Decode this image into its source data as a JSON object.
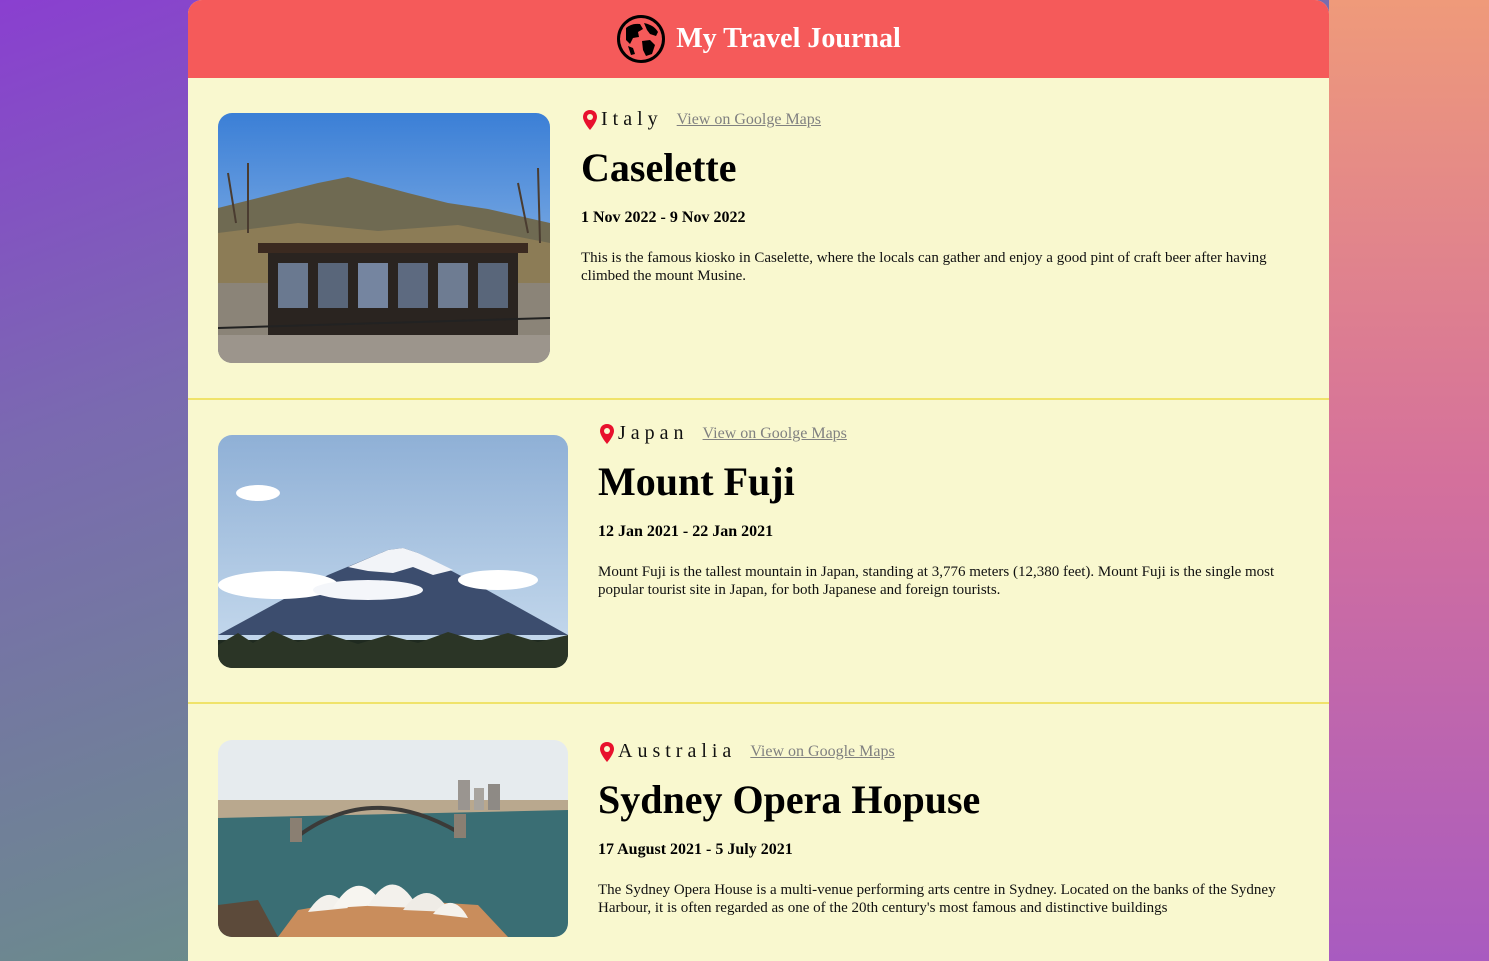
{
  "header": {
    "title": "My Travel Journal",
    "icon": "globe-icon"
  },
  "entries": [
    {
      "country": "Italy",
      "maps_label": "View on Goolge Maps",
      "title": "Caselette",
      "dates": "1 Nov 2022 - 9 Nov 2022",
      "description": "This is the famous kiosko in Caselette, where the locals can gather and enjoy a good pint of craft beer after having climbed the mount Musine."
    },
    {
      "country": "Japan",
      "maps_label": "View on Goolge Maps",
      "title": "Mount Fuji",
      "dates": "12 Jan 2021 - 22 Jan 2021",
      "description": "Mount Fuji is the tallest mountain in Japan, standing at 3,776 meters (12,380 feet). Mount Fuji is the single most popular tourist site in Japan, for both Japanese and foreign tourists."
    },
    {
      "country": "Australia",
      "maps_label": "View on Google Maps",
      "title": "Sydney Opera Hopuse",
      "dates": "17 August 2021 - 5 July 2021",
      "description": "The Sydney Opera House is a multi-venue performing arts centre in Sydney. Located on the banks of the Sydney Harbour, it is often regarded as one of the 20th century's most famous and distinctive buildings"
    }
  ],
  "colors": {
    "header_bg": "#f55a5a",
    "card_bg": "#f9f8cf",
    "divider": "#f0e36a",
    "pin": "#e8112d",
    "link": "#808080"
  }
}
